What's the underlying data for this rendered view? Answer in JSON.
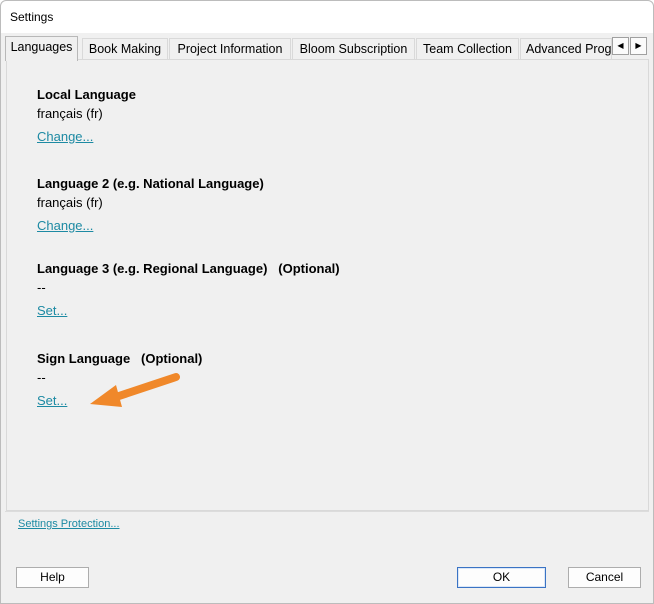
{
  "window": {
    "title": "Settings"
  },
  "tabs": [
    {
      "label": "Languages",
      "active": true
    },
    {
      "label": "Book Making",
      "active": false
    },
    {
      "label": "Project Information",
      "active": false
    },
    {
      "label": "Bloom Subscription",
      "active": false
    },
    {
      "label": "Team Collection",
      "active": false
    },
    {
      "label": "Advanced Prog",
      "active": false
    }
  ],
  "tab_scroll": {
    "left_icon": "arrow-left-icon",
    "right_icon": "arrow-right-icon"
  },
  "languages": {
    "local": {
      "heading": "Local Language",
      "value": "français (fr)",
      "link": "Change..."
    },
    "lang2": {
      "heading": "Language 2 (e.g. National Language)",
      "value": "français (fr)",
      "link": "Change..."
    },
    "lang3": {
      "heading": "Language 3 (e.g. Regional Language)   (Optional)",
      "value": "--",
      "link": "Set..."
    },
    "sign": {
      "heading": "Sign Language   (Optional)",
      "value": "--",
      "link": "Set..."
    }
  },
  "footer": {
    "protection_link": "Settings Protection...",
    "help": "Help",
    "ok": "OK",
    "cancel": "Cancel"
  },
  "colors": {
    "link": "#1d8aa3",
    "arrow": "#f0882a"
  }
}
